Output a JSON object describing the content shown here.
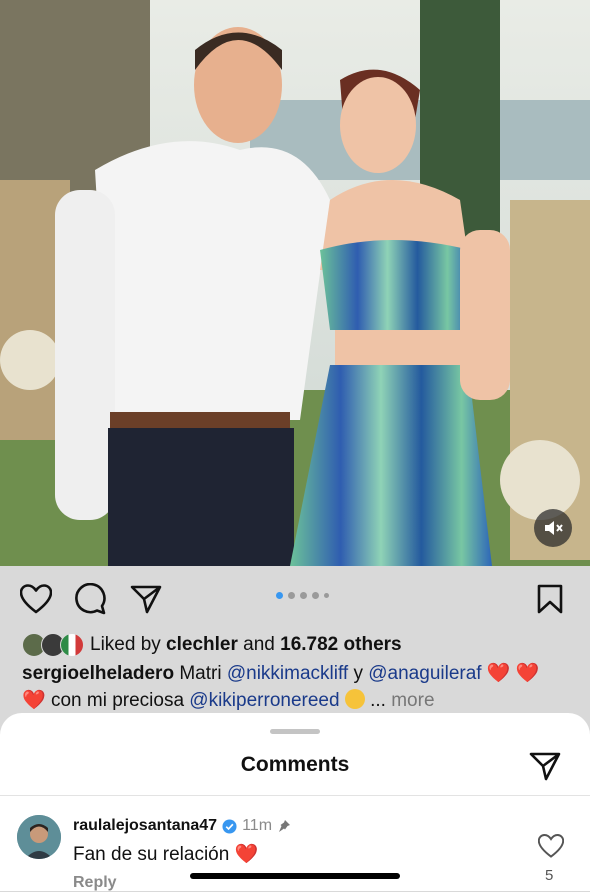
{
  "post": {
    "likes": {
      "prefix": "Liked by ",
      "user": "clechler",
      "middle": " and ",
      "count": "16.782 others"
    },
    "caption": {
      "username": "sergioelheladero",
      "text_1": " Matri ",
      "mention_1": "@nikkimackliff",
      "text_2": " y ",
      "mention_2": "@anaguileraf",
      "text_3": " con mi preciosa ",
      "mention_3": "@kikiperronereed",
      "ellipsis": "...",
      "more": "more"
    },
    "carousel": {
      "total": 5,
      "active_index": 0
    }
  },
  "icons": {
    "like": "heart-icon",
    "comment": "comment-bubble-icon",
    "share": "paper-plane-icon",
    "save": "bookmark-icon",
    "mute": "speaker-muted-icon",
    "verified": "verified-badge-icon"
  },
  "comments_sheet": {
    "title": "Comments",
    "comment": {
      "username": "raulalejosantana47",
      "time": "11m",
      "text": "Fan de su relación",
      "reply_label": "Reply",
      "like_count": "5"
    }
  },
  "colors": {
    "mention": "#1a3a8a",
    "heart": "#e0243b",
    "active_dot": "#3897f0",
    "verified": "#3897f0"
  }
}
